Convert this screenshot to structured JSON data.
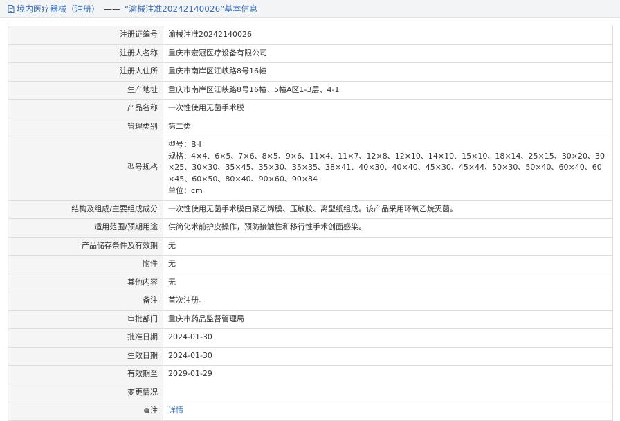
{
  "breadcrumb": {
    "section_link": "境内医疗器械（注册）",
    "separator": "——",
    "title": "“渝械注准20242140026”基本信息"
  },
  "rows": [
    {
      "label": "注册证编号",
      "value": "渝械注准20242140026"
    },
    {
      "label": "注册人名称",
      "value": "重庆市宏冠医疗设备有限公司"
    },
    {
      "label": "注册人住所",
      "value": "重庆市南岸区江峡路8号16幢"
    },
    {
      "label": "生产地址",
      "value": "重庆市南岸区江峡路8号16幢，5幢A区1-3层、4-1"
    },
    {
      "label": "产品名称",
      "value": "一次性使用无菌手术膜"
    },
    {
      "label": "管理类别",
      "value": "第二类"
    },
    {
      "label": "型号规格",
      "value_lines": [
        "型号：B-Ⅰ",
        "规格：4×4、6×5、7×6、8×5、9×6、11×4、11×7、12×8、12×10、14×10、15×10、18×14、25×15、30×20、30×25、30×30、35×45、35×30、35×35、38×41、40×30、40×40、45×30、45×44、50×30、50×40、60×40、60×45、60×50、80×40、90×60、90×84",
        "单位：cm"
      ]
    },
    {
      "label": "结构及组成/主要组成成分",
      "value": "一次性使用无菌手术膜由聚乙烯膜、压敏胶、离型纸组成。该产品采用环氧乙烷灭菌。"
    },
    {
      "label": "适用范围/预期用途",
      "value": "供简化术前护皮操作，预防接触性和移行性手术创面感染。"
    },
    {
      "label": "产品储存条件及有效期",
      "value": "无"
    },
    {
      "label": "附件",
      "value": "无"
    },
    {
      "label": "其他内容",
      "value": "无"
    },
    {
      "label": "备注",
      "value": "首次注册。"
    },
    {
      "label": "审批部门",
      "value": "重庆市药品监督管理局"
    },
    {
      "label": "批准日期",
      "value": "2024-01-30"
    },
    {
      "label": "生效日期",
      "value": "2024-01-30"
    },
    {
      "label": "有效期至",
      "value": "2029-01-29"
    },
    {
      "label": "变更情况",
      "value": ""
    },
    {
      "label": "注",
      "link": "详情"
    }
  ],
  "icons": {
    "breadcrumb": "document-icon",
    "note": "pin-icon"
  },
  "colors": {
    "link": "#3a6fb7",
    "label_bg": "#f5f5f5",
    "border": "#dcdcdc"
  }
}
